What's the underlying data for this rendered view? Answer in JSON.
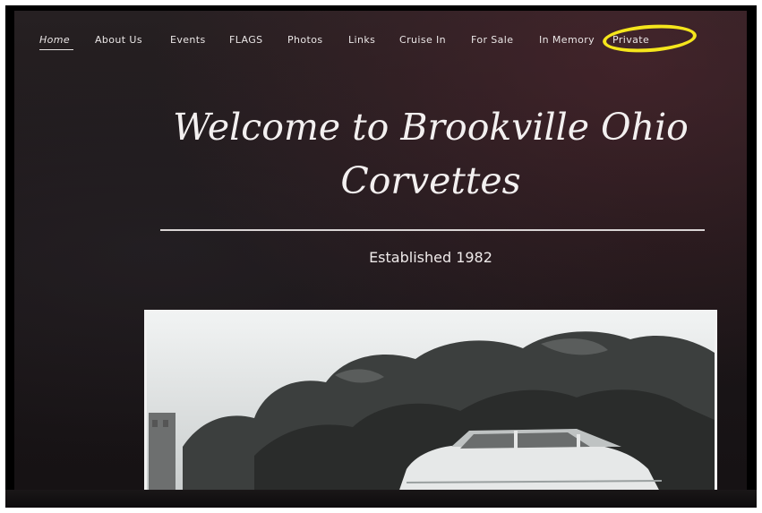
{
  "nav": {
    "items": [
      {
        "label": "Home",
        "active": true
      },
      {
        "label": "About Us"
      },
      {
        "label": "Events"
      },
      {
        "label": "FLAGS"
      },
      {
        "label": "Photos"
      },
      {
        "label": "Links"
      },
      {
        "label": "Cruise In"
      },
      {
        "label": "For Sale"
      },
      {
        "label": "In Memory"
      },
      {
        "label": "Private"
      }
    ],
    "highlight_color": "#f5e61c"
  },
  "hero": {
    "title_line1": "Welcome to Brookville Ohio",
    "title_line2": "Corvettes",
    "subtitle": "Established 1982"
  },
  "colors": {
    "background": "#1c1719",
    "text": "#efeaea"
  }
}
